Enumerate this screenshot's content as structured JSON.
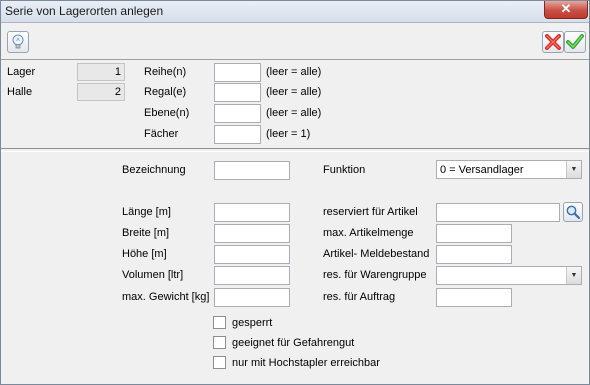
{
  "window": {
    "title": "Serie von Lagerorten anlegen",
    "close_glyph": "✕"
  },
  "toolbar": {
    "hint_icon": "lightbulb-icon",
    "cancel_icon": "red-x-icon",
    "ok_icon": "green-check-icon",
    "cancel_color": "#d9302a",
    "ok_color": "#3aa535"
  },
  "top": {
    "lager_label": "Lager",
    "lager_value": "1",
    "halle_label": "Halle",
    "halle_value": "2",
    "reihe_label": "Reihe(n)",
    "reihe_value": "",
    "reihe_hint": "(leer = alle)",
    "regal_label": "Regal(e)",
    "regal_value": "",
    "regal_hint": "(leer = alle)",
    "ebene_label": "Ebene(n)",
    "ebene_value": "",
    "ebene_hint": "(leer = alle)",
    "faecher_label": "Fächer",
    "faecher_value": "",
    "faecher_hint": "(leer = 1)"
  },
  "form": {
    "bezeichnung_label": "Bezeichnung",
    "bezeichnung_value": "",
    "funktion_label": "Funktion",
    "funktion_value": "0 = Versandlager",
    "laenge_label": "Länge [m]",
    "laenge_value": "",
    "breite_label": "Breite [m]",
    "breite_value": "",
    "hoehe_label": "Höhe [m]",
    "hoehe_value": "",
    "volumen_label": "Volumen [ltr]",
    "volumen_value": "",
    "gewicht_label": "max. Gewicht [kg]",
    "gewicht_value": "",
    "reserviert_label": "reserviert für Artikel",
    "reserviert_value": "",
    "max_menge_label": "max. Artikelmenge",
    "max_menge_value": "",
    "meldebestand_label": "Artikel- Meldebestand",
    "meldebestand_value": "",
    "warengruppe_label": "res. für Warengruppe",
    "warengruppe_value": "",
    "auftrag_label": "res. für Auftrag",
    "auftrag_value": ""
  },
  "checks": {
    "gesperrt_label": "gesperrt",
    "gesperrt_checked": false,
    "gefahrengut_label": "geeignet für Gefahrengut",
    "gefahrengut_checked": false,
    "hochstapler_label": "nur mit Hochstapler erreichbar",
    "hochstapler_checked": false
  },
  "icons": {
    "search": "magnifier-icon",
    "dropdown": "chevron-down-icon"
  }
}
